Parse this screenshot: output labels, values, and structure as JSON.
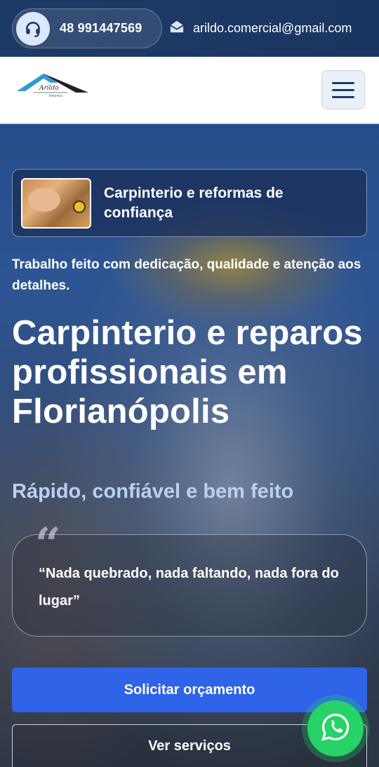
{
  "topbar": {
    "phone": "48 991447569",
    "email": "arildo.comercial@gmail.com",
    "phone_icon": "headset-icon",
    "email_icon": "envelope-open-icon"
  },
  "header": {
    "logo_text": "Arildo",
    "logo_subtext": "Reformas",
    "menu_icon": "hamburger-menu-icon"
  },
  "hero": {
    "feature_card": "Carpinterio e reformas de confiança",
    "intro": "Trabalho feito com dedicação, qualidade e atenção aos detalhes.",
    "title": "Carpinterio e reparos profissionais em Florianópolis",
    "subtitle": "Rápido, confiável e bem feito",
    "quote_mark": "“",
    "quote": "“Nada quebrado, nada faltando, nada fora do lugar”",
    "cta_primary": "Solicitar orçamento",
    "cta_secondary": "Ver serviços"
  },
  "whatsapp": {
    "icon": "whatsapp-icon"
  },
  "colors": {
    "topbar_bg": "#1d3a66",
    "primary_button": "#2f63e8",
    "subtitle": "#b9d0f3",
    "whatsapp": "#25d366"
  }
}
